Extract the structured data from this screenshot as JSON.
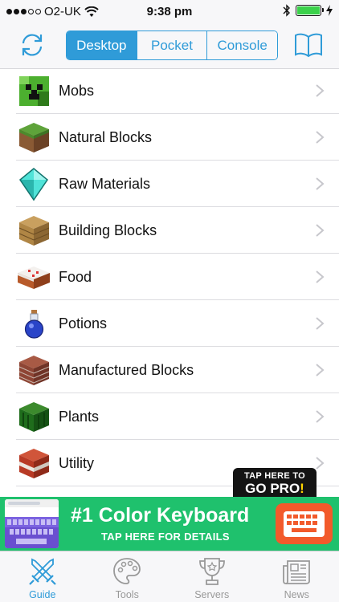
{
  "status_bar": {
    "carrier": "O2-UK",
    "time": "9:38 pm",
    "battery_level": 1.0
  },
  "header": {
    "segments": [
      {
        "label": "Desktop",
        "active": true
      },
      {
        "label": "Pocket",
        "active": false
      },
      {
        "label": "Console",
        "active": false
      }
    ],
    "left_icon": "sync-icon",
    "right_icon": "book-icon"
  },
  "categories": [
    {
      "label": "Mobs",
      "icon": "creeper-icon"
    },
    {
      "label": "Natural Blocks",
      "icon": "grass-block-icon"
    },
    {
      "label": "Raw Materials",
      "icon": "diamond-icon"
    },
    {
      "label": "Building Blocks",
      "icon": "planks-icon"
    },
    {
      "label": "Food",
      "icon": "cake-icon"
    },
    {
      "label": "Potions",
      "icon": "potion-icon"
    },
    {
      "label": "Manufactured Blocks",
      "icon": "bricks-icon"
    },
    {
      "label": "Plants",
      "icon": "cactus-icon"
    },
    {
      "label": "Utility",
      "icon": "tnt-icon"
    }
  ],
  "pro_badge": {
    "line1": "TAP HERE TO",
    "line2_main": "GO PRO",
    "line2_mark": "!"
  },
  "ad": {
    "title": "#1 Color Keyboard",
    "subtitle": "TAP HERE FOR DETAILS",
    "color": "#1fc16d"
  },
  "tabs": [
    {
      "label": "Guide",
      "icon": "swords-icon",
      "active": true
    },
    {
      "label": "Tools",
      "icon": "palette-icon",
      "active": false
    },
    {
      "label": "Servers",
      "icon": "trophy-icon",
      "active": false
    },
    {
      "label": "News",
      "icon": "newspaper-icon",
      "active": false
    }
  ],
  "colors": {
    "accent": "#2f9bd8",
    "inactive_tab": "#999999"
  }
}
